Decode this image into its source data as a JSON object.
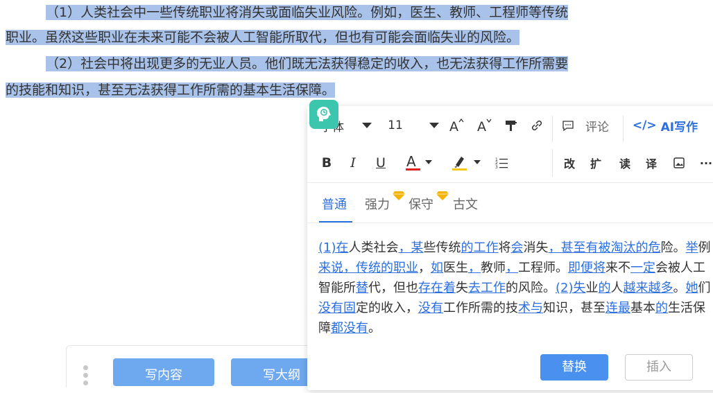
{
  "document": {
    "paragraph1_line1": "（1）人类社会中一些传统职业将消失或面临失业风险。例如，医生、教师、工程师等传统",
    "paragraph1_line2": "职业。虽然这些职业在未来可能不会被人工智能所取代，但也有可能会面临失业的风险。",
    "paragraph2_line1": "（2）社会中将出现更多的无业人员。他们既无法获得稳定的收入，也无法获得工作所需要",
    "paragraph2_line2": "的技能和知识，甚至无法获得工作所需的基本生活保障。"
  },
  "bottom_toolbar": {
    "write_content_label": "写内容",
    "write_outline_label": "写大纲"
  },
  "toolbar": {
    "font_family": "字体",
    "font_size": "11",
    "comment_label": "评论",
    "ai_write_label": "AI写作",
    "rewrite_label": "改",
    "expand_label": "扩",
    "read_label": "读",
    "translate_label": "译",
    "more_label": "···"
  },
  "tabs": [
    {
      "label": "普通",
      "active": true
    },
    {
      "label": "强力",
      "premium": true
    },
    {
      "label": "保守",
      "premium": true
    },
    {
      "label": "古文"
    }
  ],
  "result": {
    "segments": [
      [
        "(1)",
        "u"
      ],
      [
        "在",
        "u"
      ],
      [
        "人类社会",
        ""
      ],
      [
        "，某",
        "u"
      ],
      [
        "些传统",
        ""
      ],
      [
        "的工作",
        "u"
      ],
      [
        "将",
        ""
      ],
      [
        "会",
        "u"
      ],
      [
        "消失",
        ""
      ],
      [
        "，甚至有被淘汰的危",
        "u"
      ],
      [
        "险。",
        ""
      ],
      [
        "举",
        "u"
      ],
      [
        "例",
        ""
      ],
      [
        "来说，传统的职业",
        "u"
      ],
      [
        "，",
        ""
      ],
      [
        "如",
        "u"
      ],
      [
        "医生",
        ""
      ],
      [
        "，",
        "u"
      ],
      [
        "教师",
        ""
      ],
      [
        "，",
        "u"
      ],
      [
        "工程师。",
        ""
      ],
      [
        "即便将",
        "u"
      ],
      [
        "来不",
        ""
      ],
      [
        "一定",
        "u"
      ],
      [
        "会被人工智能所",
        ""
      ],
      [
        "替",
        "u"
      ],
      [
        "代，但也",
        ""
      ],
      [
        "存在着",
        "u"
      ],
      [
        "失",
        ""
      ],
      [
        "去工作",
        "u"
      ],
      [
        "的风险。",
        ""
      ],
      [
        "(2)",
        "u"
      ],
      [
        "失",
        "u"
      ],
      [
        "业",
        ""
      ],
      [
        "的",
        "u"
      ],
      [
        "人",
        ""
      ],
      [
        "越来越多",
        "u"
      ],
      [
        "。",
        ""
      ],
      [
        "她",
        "u"
      ],
      [
        "们",
        ""
      ],
      [
        "没有固",
        "u"
      ],
      [
        "定的收入，",
        ""
      ],
      [
        "没有",
        "u"
      ],
      [
        "工作所需的技",
        ""
      ],
      [
        "术与",
        "u"
      ],
      [
        "知识，甚至",
        ""
      ],
      [
        "连最",
        "u"
      ],
      [
        "基本",
        ""
      ],
      [
        "的",
        "u"
      ],
      [
        "生活保障",
        ""
      ],
      [
        "都没有",
        "u"
      ],
      [
        "。",
        ""
      ]
    ]
  },
  "actions": {
    "replace_label": "替换",
    "insert_label": "插入"
  },
  "colors": {
    "selection_highlight": "#a8c2ea",
    "accent_blue": "#2c6fde",
    "assistant_icon": "#3cc6ad",
    "font_color_underline": "#e02020",
    "highlight_marker": "#f5c518"
  }
}
